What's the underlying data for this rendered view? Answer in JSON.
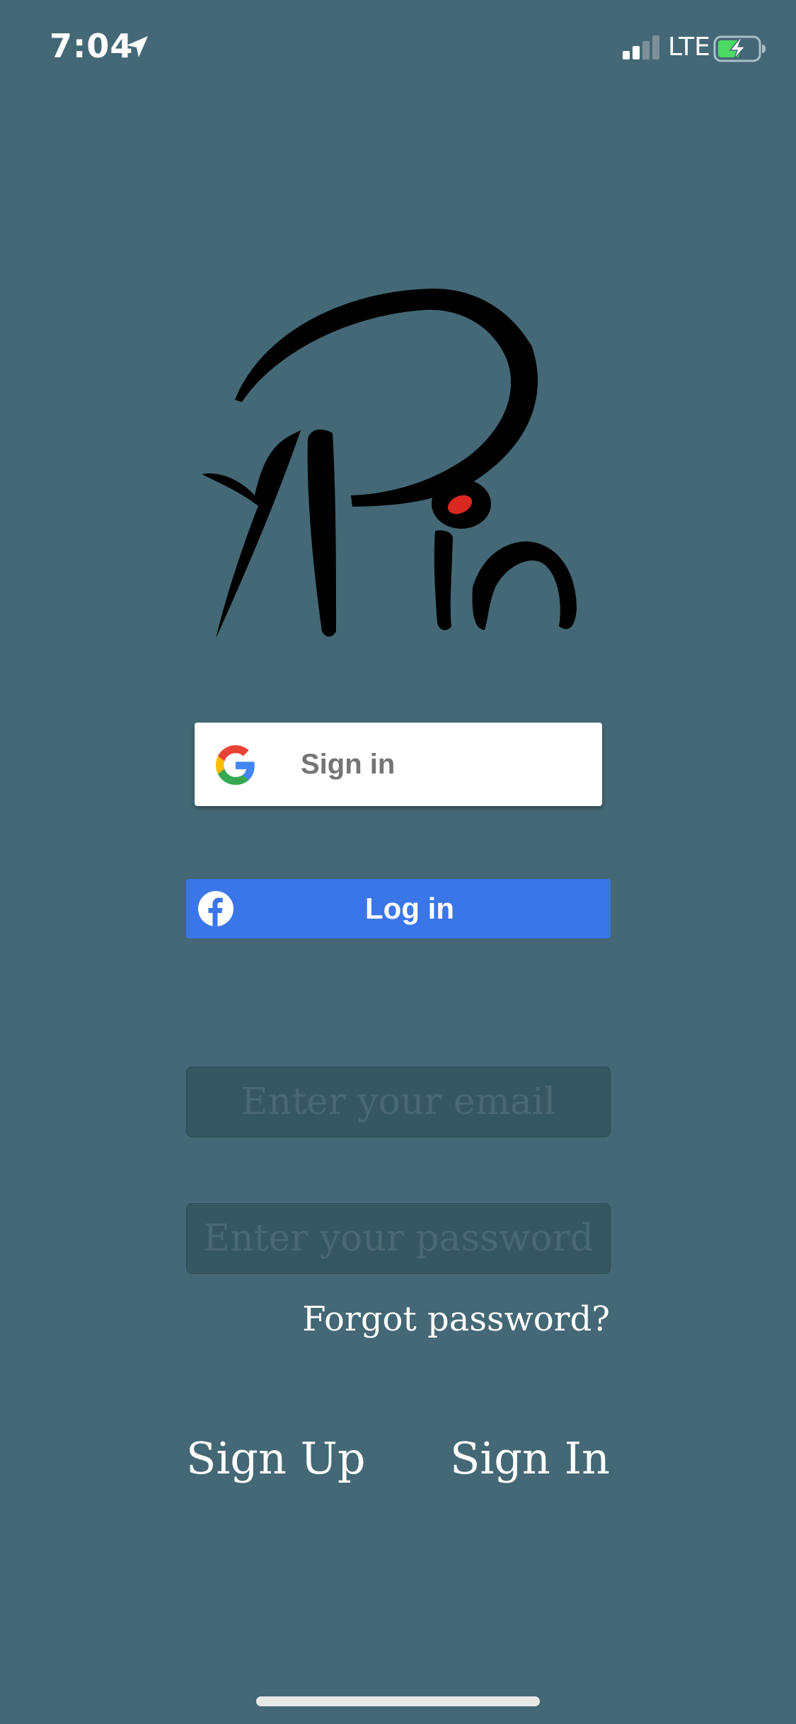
{
  "status_bar": {
    "time": "7:04",
    "network": "LTE",
    "location_icon": "location-arrow-icon",
    "signal_icon": "cellular-signal-icon",
    "battery_icon": "battery-charging-icon",
    "battery_color": "#4cd964"
  },
  "logo": {
    "icon": "ypin-logo",
    "accent_color": "#d8281f"
  },
  "google_button": {
    "label": "Sign in",
    "icon": "google-icon"
  },
  "facebook_button": {
    "label": "Log in",
    "icon": "facebook-icon",
    "color": "#3b76e8"
  },
  "form": {
    "email_placeholder": "Enter your email",
    "email_value": "",
    "password_placeholder": "Enter your password",
    "password_value": "",
    "forgot_password_label": "Forgot password?"
  },
  "footer": {
    "signup_label": "Sign Up",
    "signin_label": "Sign In"
  },
  "theme": {
    "background": "#446875"
  }
}
